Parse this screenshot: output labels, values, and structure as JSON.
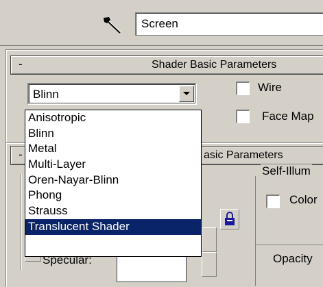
{
  "toolbar": {
    "picker_icon": "eyedropper-icon",
    "name_field_value": "Screen"
  },
  "shader_rollout": {
    "collapse_symbol": "-",
    "title": "Shader Basic Parameters",
    "shader_combo_value": "Blinn",
    "wire_label": "Wire",
    "face_map_label": "Face Map"
  },
  "shader_dropdown": {
    "items": [
      "Anisotropic",
      "Blinn",
      "Metal",
      "Multi-Layer",
      "Oren-Nayar-Blinn",
      "Phong",
      "Strauss",
      "Translucent Shader"
    ],
    "selected": "Translucent Shader"
  },
  "basic_rollout": {
    "collapse_symbol": "-",
    "title_partial": "asic Parameters",
    "self_illum_label": "Self-Illum",
    "color_label": "Color",
    "specular_label": "Specular:",
    "opacity_label": "Opacity",
    "lock_icon": "lock-icon"
  }
}
